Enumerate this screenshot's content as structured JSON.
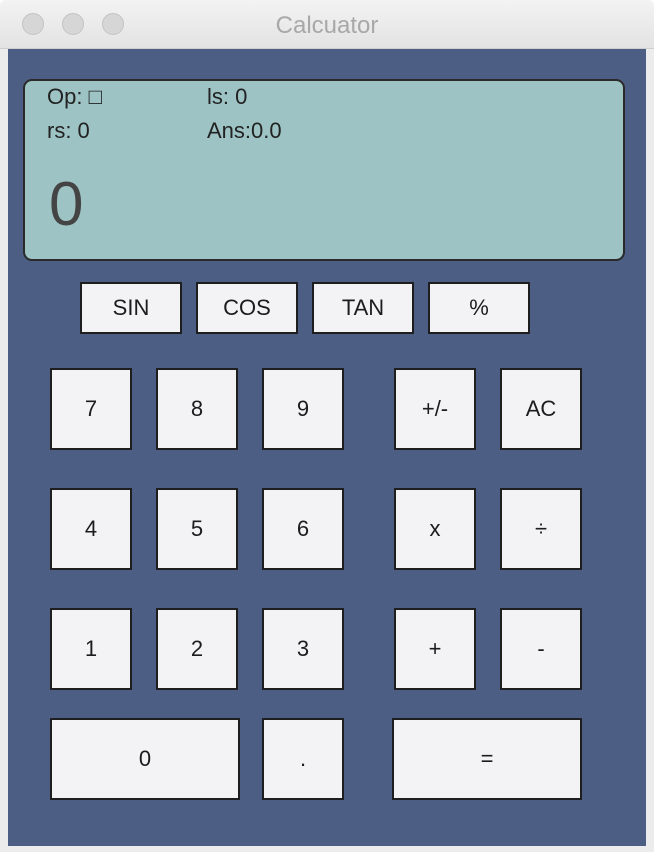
{
  "window": {
    "title": "Calcuator"
  },
  "display": {
    "op_label": "Op: □",
    "ls_label": "ls: 0",
    "rs_label": "rs: 0",
    "ans_label": "Ans:0.0",
    "value": "0"
  },
  "functions": {
    "sin": "SIN",
    "cos": "COS",
    "tan": "TAN",
    "percent": "%"
  },
  "keys": {
    "k7": "7",
    "k8": "8",
    "k9": "9",
    "negate": "+/-",
    "clear": "AC",
    "k4": "4",
    "k5": "5",
    "k6": "6",
    "multiply": "x",
    "divide": "÷",
    "k1": "1",
    "k2": "2",
    "k3": "3",
    "plus": "+",
    "minus": "-",
    "k0": "0",
    "dot": ".",
    "equals": "="
  },
  "colors": {
    "panel_bg": "#4d5e85",
    "display_bg": "#9dc3c4",
    "button_bg": "#f3f3f5"
  }
}
